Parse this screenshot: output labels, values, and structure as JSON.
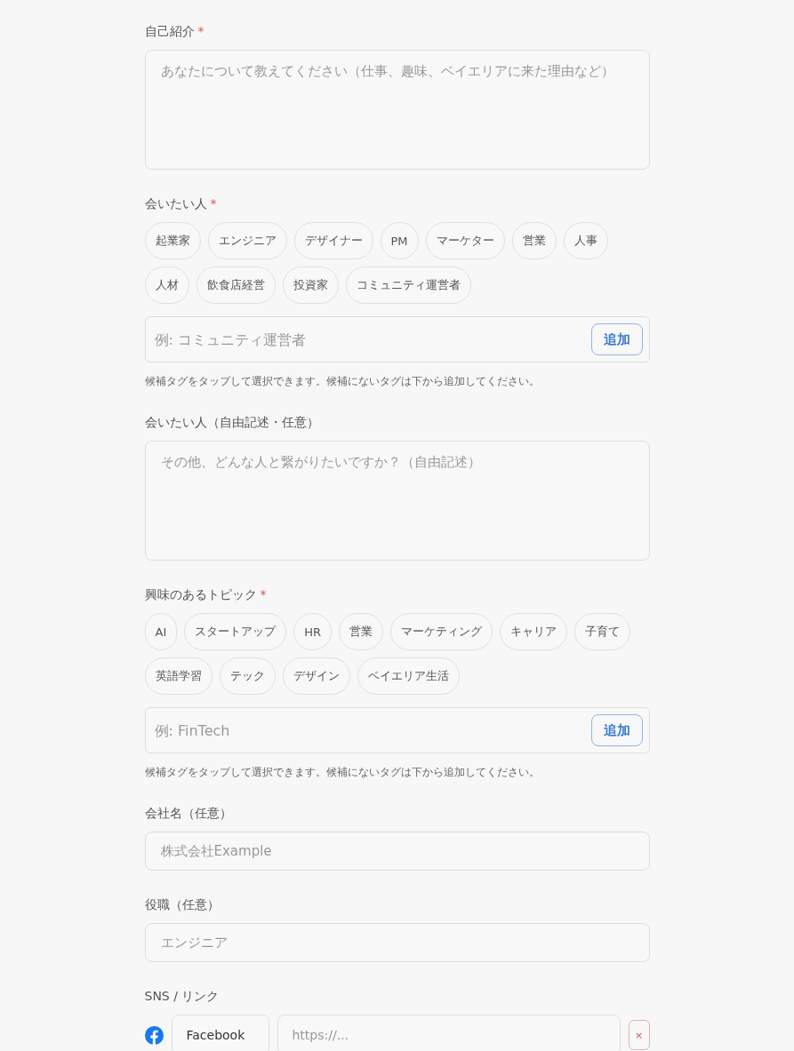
{
  "sections": [
    {
      "kind": "textarea",
      "label": "自己紹介",
      "required_mark": "*",
      "placeholder": "あなたについて教えてください（仕事、趣味、ベイエリアに来た理由など）"
    },
    {
      "kind": "tags",
      "label": "会いたい人",
      "required_mark": "*",
      "tags": [
        {
          "label": "起業家",
          "selected": false
        },
        {
          "label": "エンジニア",
          "selected": false
        },
        {
          "label": "デザイナー",
          "selected": false
        },
        {
          "label": "PM",
          "selected": false
        },
        {
          "label": "マーケター",
          "selected": false
        },
        {
          "label": "営業",
          "selected": false
        },
        {
          "label": "人事",
          "selected": false
        },
        {
          "label": "人材",
          "selected": false
        },
        {
          "label": "飲食店経営",
          "selected": false
        },
        {
          "label": "投資家",
          "selected": false
        },
        {
          "label": "コミュニティ運営者",
          "selected": false
        }
      ],
      "input": {
        "placeholder": "例: コミュニティ運営者",
        "button": "追加"
      },
      "hint": "候補タグをタップして選択できます。候補にないタグは下から追加してください。"
    },
    {
      "kind": "textarea",
      "label": "会いたい人（自由記述・任意）",
      "placeholder": "その他、どんな人と繋がりたいですか？（自由記述）"
    },
    {
      "kind": "tags",
      "label": "興味のあるトピック",
      "required_mark": "*",
      "tags": [
        {
          "label": "AI",
          "selected": false
        },
        {
          "label": "スタートアップ",
          "selected": false
        },
        {
          "label": "HR",
          "selected": false
        },
        {
          "label": "営業",
          "selected": false
        },
        {
          "label": "マーケティング",
          "selected": false
        },
        {
          "label": "キャリア",
          "selected": false
        },
        {
          "label": "子育て",
          "selected": false
        },
        {
          "label": "英語学習",
          "selected": false
        },
        {
          "label": "テック",
          "selected": false
        },
        {
          "label": "デザイン",
          "selected": false
        },
        {
          "label": "ベイエリア生活",
          "selected": false
        }
      ],
      "input": {
        "placeholder": "例: FinTech",
        "button": "追加"
      },
      "hint": "候補タグをタップして選択できます。候補にないタグは下から追加してください。"
    },
    {
      "kind": "input",
      "label": "会社名（任意）",
      "placeholder": "株式会社Example"
    },
    {
      "kind": "input",
      "label": "役職（任意）",
      "placeholder": "エンジニア"
    },
    {
      "kind": "sns",
      "label": "SNS / リンク",
      "links": [
        {
          "service": "Facebook",
          "placeholder": "https://...",
          "remove": "×"
        }
      ]
    }
  ]
}
